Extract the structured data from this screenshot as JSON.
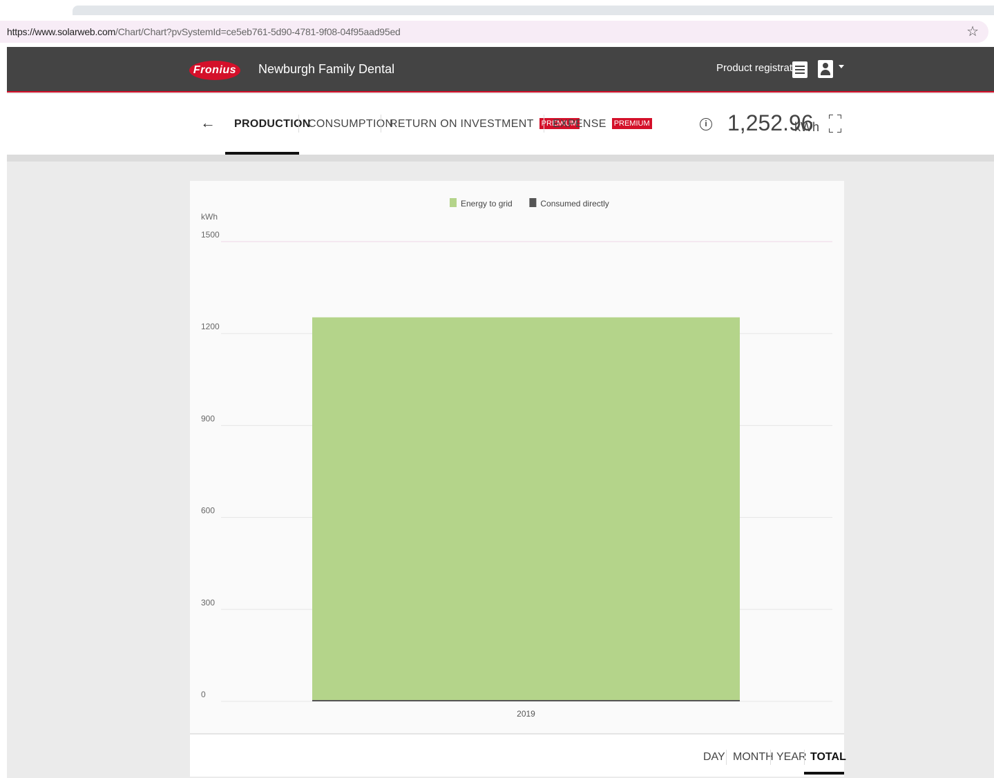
{
  "browser": {
    "url_host": "https://www.solarweb.com",
    "url_path": "/Chart/Chart?pvSystemId=ce5eb761-5d90-4781-9f08-04f95aad95ed",
    "star_icon": "☆"
  },
  "header": {
    "logo_text": "Fronius",
    "site_name": "Newburgh Family Dental",
    "product_registration": "Product registration"
  },
  "tabs": {
    "back_icon": "←",
    "items": [
      {
        "label": "PRODUCTION",
        "badge": ""
      },
      {
        "label": "CONSUMPTION",
        "badge": ""
      },
      {
        "label": "RETURN ON INVESTMENT",
        "badge": "PREMIUM"
      },
      {
        "label": "EXPENSE",
        "badge": "PREMIUM"
      }
    ],
    "active": "PRODUCTION",
    "info_icon": "i",
    "total_value": "1,252.96",
    "total_unit": "kWh"
  },
  "ranges": {
    "items": [
      "DAY",
      "MONTH",
      "YEAR",
      "TOTAL"
    ],
    "active": "TOTAL"
  },
  "colors": {
    "brand_red": "#d4102a",
    "header_bg": "#444444",
    "energy_to_grid": "#b4d48a",
    "consumed_directly": "#555555"
  },
  "chart_data": {
    "type": "bar",
    "stacked": true,
    "ylabel": "kWh",
    "ylim": [
      0,
      1500
    ],
    "yticks": [
      "0",
      "300",
      "600",
      "900",
      "1200",
      "1500"
    ],
    "categories": [
      "2019"
    ],
    "series": [
      {
        "name": "Energy to grid",
        "values": [
          1252.96
        ],
        "color": "#b4d48a"
      },
      {
        "name": "Consumed directly",
        "values": [
          0
        ],
        "color": "#555555"
      }
    ],
    "legend_position": "top-center",
    "grid": true
  }
}
